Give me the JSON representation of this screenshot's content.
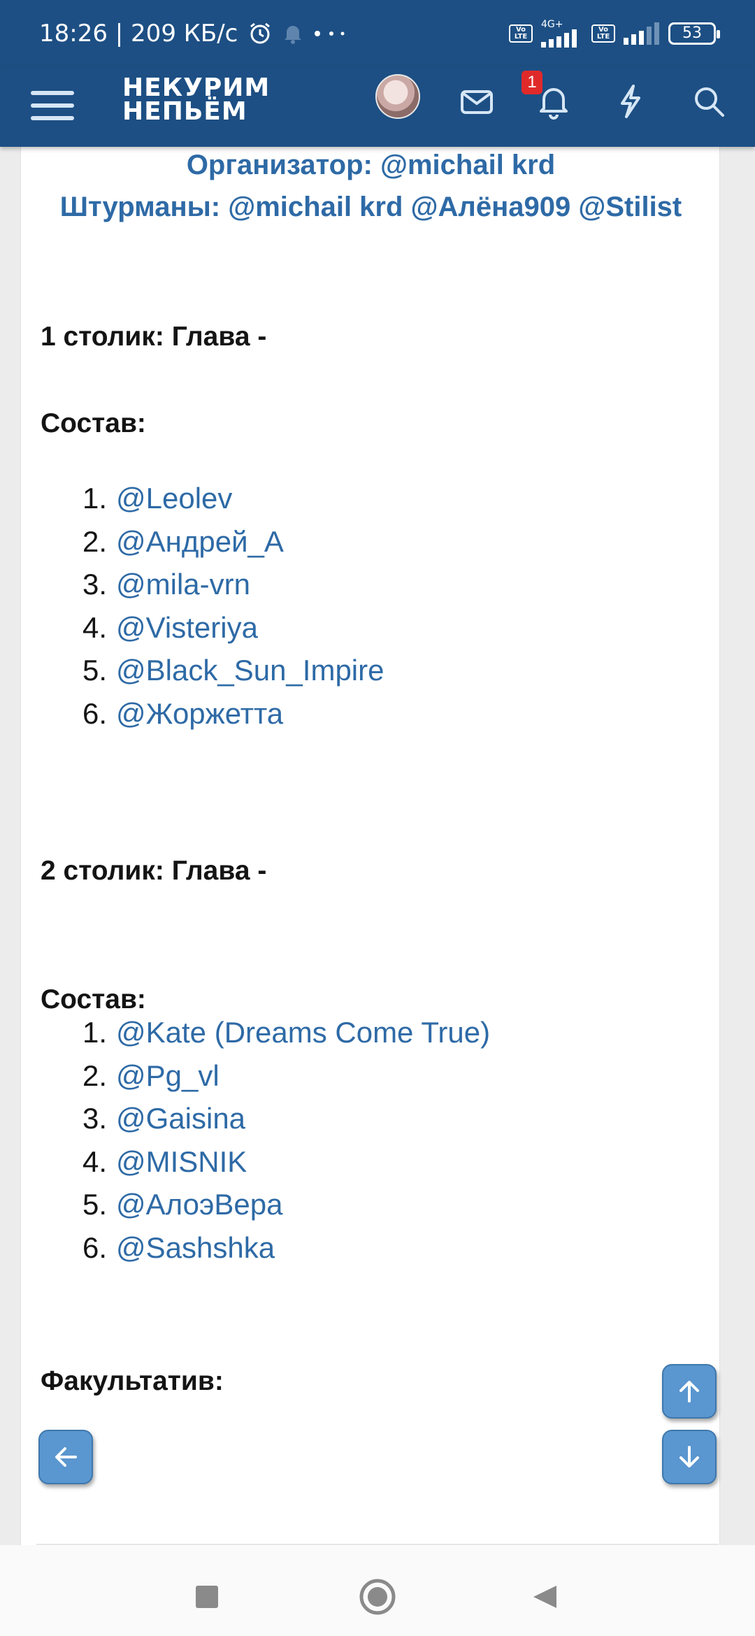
{
  "status_bar": {
    "time_speed": "18:26 | 209 КБ/с",
    "network": "4G+",
    "battery": "53",
    "volte": "Vo LTE"
  },
  "header": {
    "logo_line1": "НЕКУРИМ",
    "logo_line2": "НЕПЬЁМ",
    "notification_count": "1",
    "icons": [
      "menu-icon",
      "avatar",
      "mail-icon",
      "bell-icon",
      "lightning-icon",
      "search-icon"
    ]
  },
  "post": {
    "organizer_line": "Организатор: @michail krd",
    "navigators_line": "Штурманы: @michail krd @Алёна909 @Stilist",
    "tables": [
      {
        "title": "1 столик: Глава -",
        "composition_label": "Состав:",
        "members": [
          "@Leolev",
          "@Андрей_А",
          "@mila-vrn",
          "@Visteriya",
          "@Black_Sun_Impire",
          "@Жоржетта"
        ]
      },
      {
        "title": "2 столик: Глава -",
        "composition_label": "Состав:",
        "members": [
          "@Kate (Dreams Come True)",
          "@Pg_vl",
          "@Gaisina",
          "@MISNIK",
          "@АлоэВера",
          "@Sashshka"
        ]
      }
    ],
    "elective_label": "Факультатив:"
  },
  "colors": {
    "header_bg": "#1d4f84",
    "link": "#2e6aa6",
    "fab": "#5a96cf",
    "badge": "#e02a2a"
  }
}
